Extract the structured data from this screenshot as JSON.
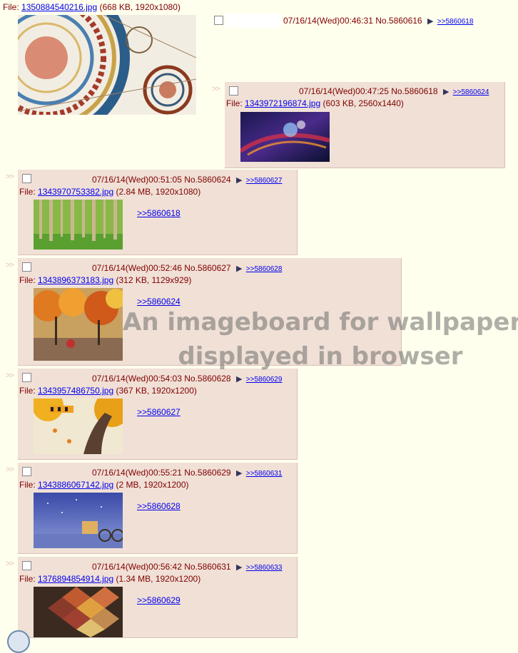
{
  "op": {
    "file_prefix": "File:",
    "file_name": "1350884540216.jpg",
    "file_info": "(668 KB, 1920x1080)",
    "datetime": "07/16/14(Wed)00:46:31",
    "post_no": "No.5860616",
    "backlink": ">>5860618"
  },
  "replies": [
    {
      "datetime": "07/16/14(Wed)00:47:25",
      "post_no": "No.5860618",
      "backlink": ">>5860624",
      "file_name": "1343972196874.jpg",
      "file_info": "(603 KB, 2560x1440)",
      "quote": ""
    },
    {
      "datetime": "07/16/14(Wed)00:51:05",
      "post_no": "No.5860624",
      "backlink": ">>5860627",
      "file_name": "1343970753382.jpg",
      "file_info": "(2.84 MB, 1920x1080)",
      "quote": ">>5860618"
    },
    {
      "datetime": "07/16/14(Wed)00:52:46",
      "post_no": "No.5860627",
      "backlink": ">>5860628",
      "file_name": "1343896373183.jpg",
      "file_info": "(312 KB, 1129x929)",
      "quote": ">>5860624"
    },
    {
      "datetime": "07/16/14(Wed)00:54:03",
      "post_no": "No.5860628",
      "backlink": ">>5860629",
      "file_name": "1343957486750.jpg",
      "file_info": "(367 KB, 1920x1200)",
      "quote": ">>5860627"
    },
    {
      "datetime": "07/16/14(Wed)00:55:21",
      "post_no": "No.5860629",
      "backlink": ">>5860631",
      "file_name": "1343886067142.jpg",
      "file_info": "(2 MB, 1920x1200)",
      "quote": ">>5860628"
    },
    {
      "datetime": "07/16/14(Wed)00:56:42",
      "post_no": "No.5860631",
      "backlink": ">>5860633",
      "file_name": "1376894854914.jpg",
      "file_info": "(1.34 MB, 1920x1200)",
      "quote": ">>5860629"
    }
  ],
  "file_prefix": "File:",
  "arrows": ">>",
  "watermark": {
    "line1": "An imageboard for wallpapers",
    "line2": "displayed in browser"
  },
  "colors": {
    "background": "#ffffee",
    "post_bg": "#f0e0d6",
    "text": "#800000",
    "link": "#0000ee"
  }
}
